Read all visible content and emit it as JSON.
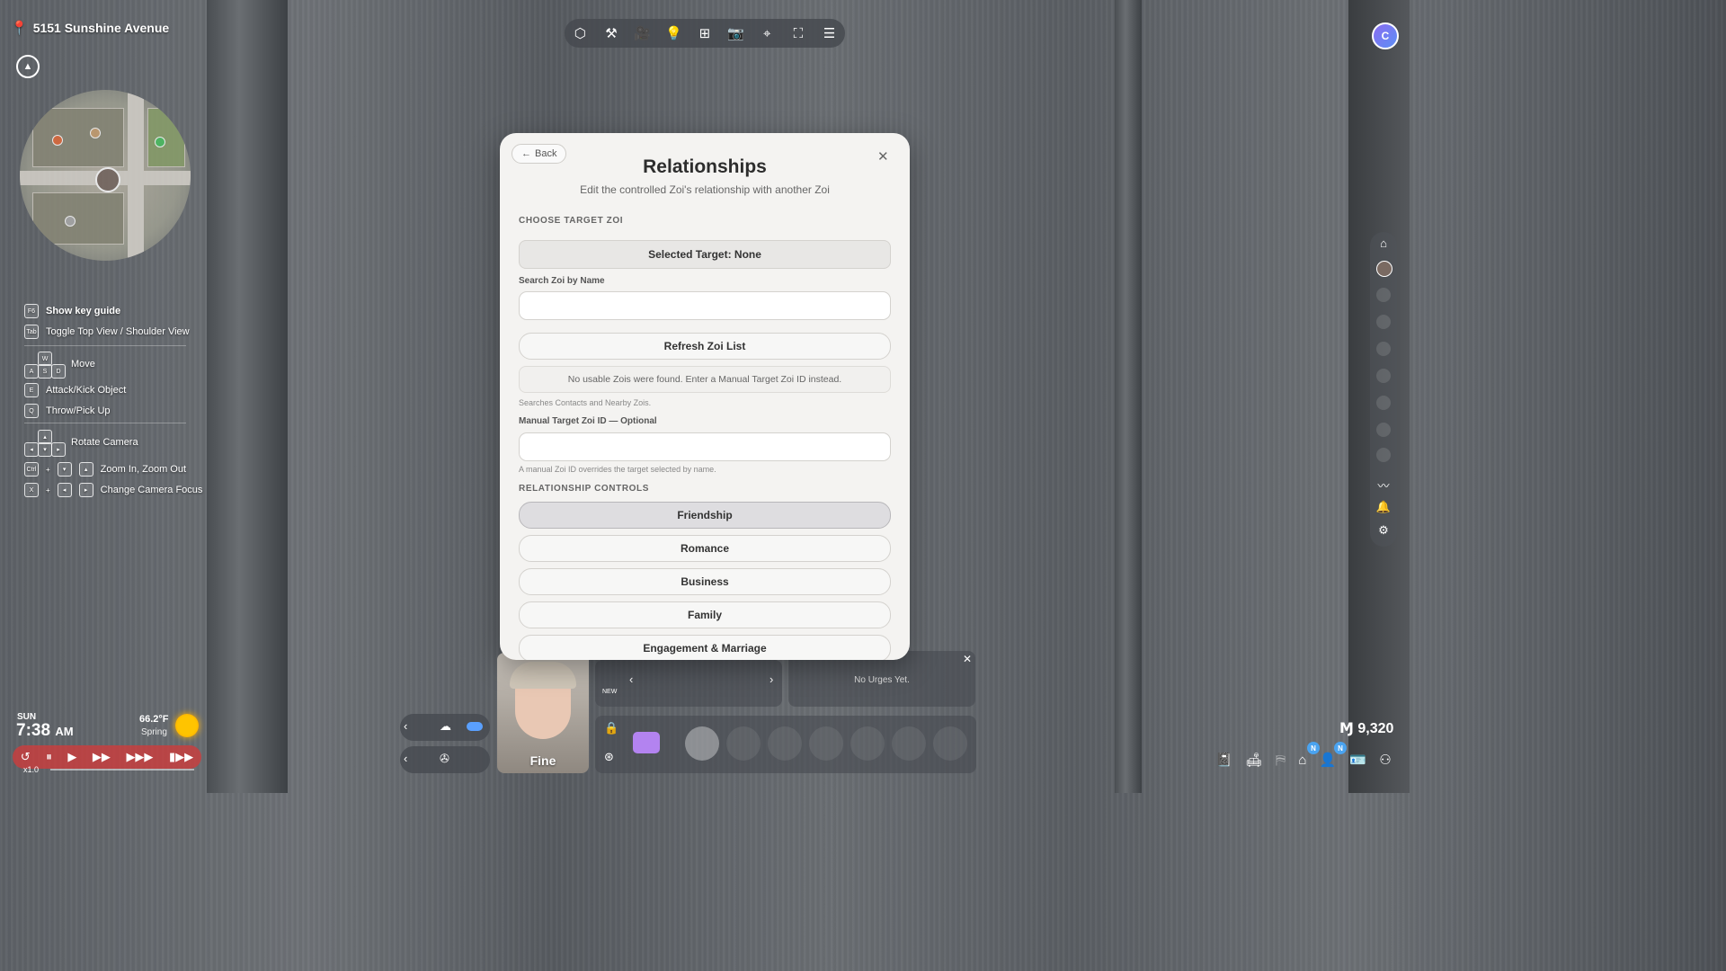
{
  "location": {
    "address": "5151 Sunshine Avenue"
  },
  "key_guide": {
    "title": "Show key guide",
    "title_key": "F6",
    "items": [
      {
        "keys": "Tab",
        "label": "Toggle Top View / Shoulder View"
      },
      {
        "keys": "WASD",
        "label": "Move"
      },
      {
        "keys": "E",
        "label": "Attack/Kick Object"
      },
      {
        "keys": "Q",
        "label": "Throw/Pick Up"
      },
      {
        "keys": "Arrows",
        "label": "Rotate Camera"
      },
      {
        "keys": "Ctrl",
        "label": "Zoom In, Zoom Out"
      },
      {
        "keys": "X",
        "label": "Change Camera Focus"
      }
    ]
  },
  "clock": {
    "day": "SUN",
    "time": "7:38",
    "ampm": "AM",
    "temperature": "66.2°F",
    "season": "Spring",
    "speed": "x1.0"
  },
  "money": "Ɱ 9,320",
  "character": {
    "mood": "Fine"
  },
  "urges": {
    "empty_text": "No Urges Yet.",
    "new_label": "NEW"
  },
  "modal": {
    "back_label": "Back",
    "title": "Relationships",
    "subtitle": "Edit the controlled Zoi's relationship with another Zoi",
    "choose_section": "CHOOSE TARGET ZOI",
    "selected_target": "Selected Target: None",
    "search_label": "Search Zoi by Name",
    "search_value": "",
    "refresh_label": "Refresh Zoi List",
    "no_zoi_notice": "No usable Zois were found. Enter a Manual Target Zoi ID instead.",
    "search_hint": "Searches Contacts and Nearby Zois.",
    "manual_label": "Manual Target Zoi ID — Optional",
    "manual_value": "",
    "manual_hint": "A manual Zoi ID overrides the target selected by name.",
    "controls_section": "RELATIONSHIP CONTROLS",
    "controls": [
      "Friendship",
      "Romance",
      "Business",
      "Family",
      "Engagement & Marriage"
    ]
  },
  "colors": {
    "modal_bg": "#f4f3f1",
    "speed_bar": "#cd3c3c",
    "accent_blue": "#5aa0ff",
    "sun": "#ffc400"
  }
}
